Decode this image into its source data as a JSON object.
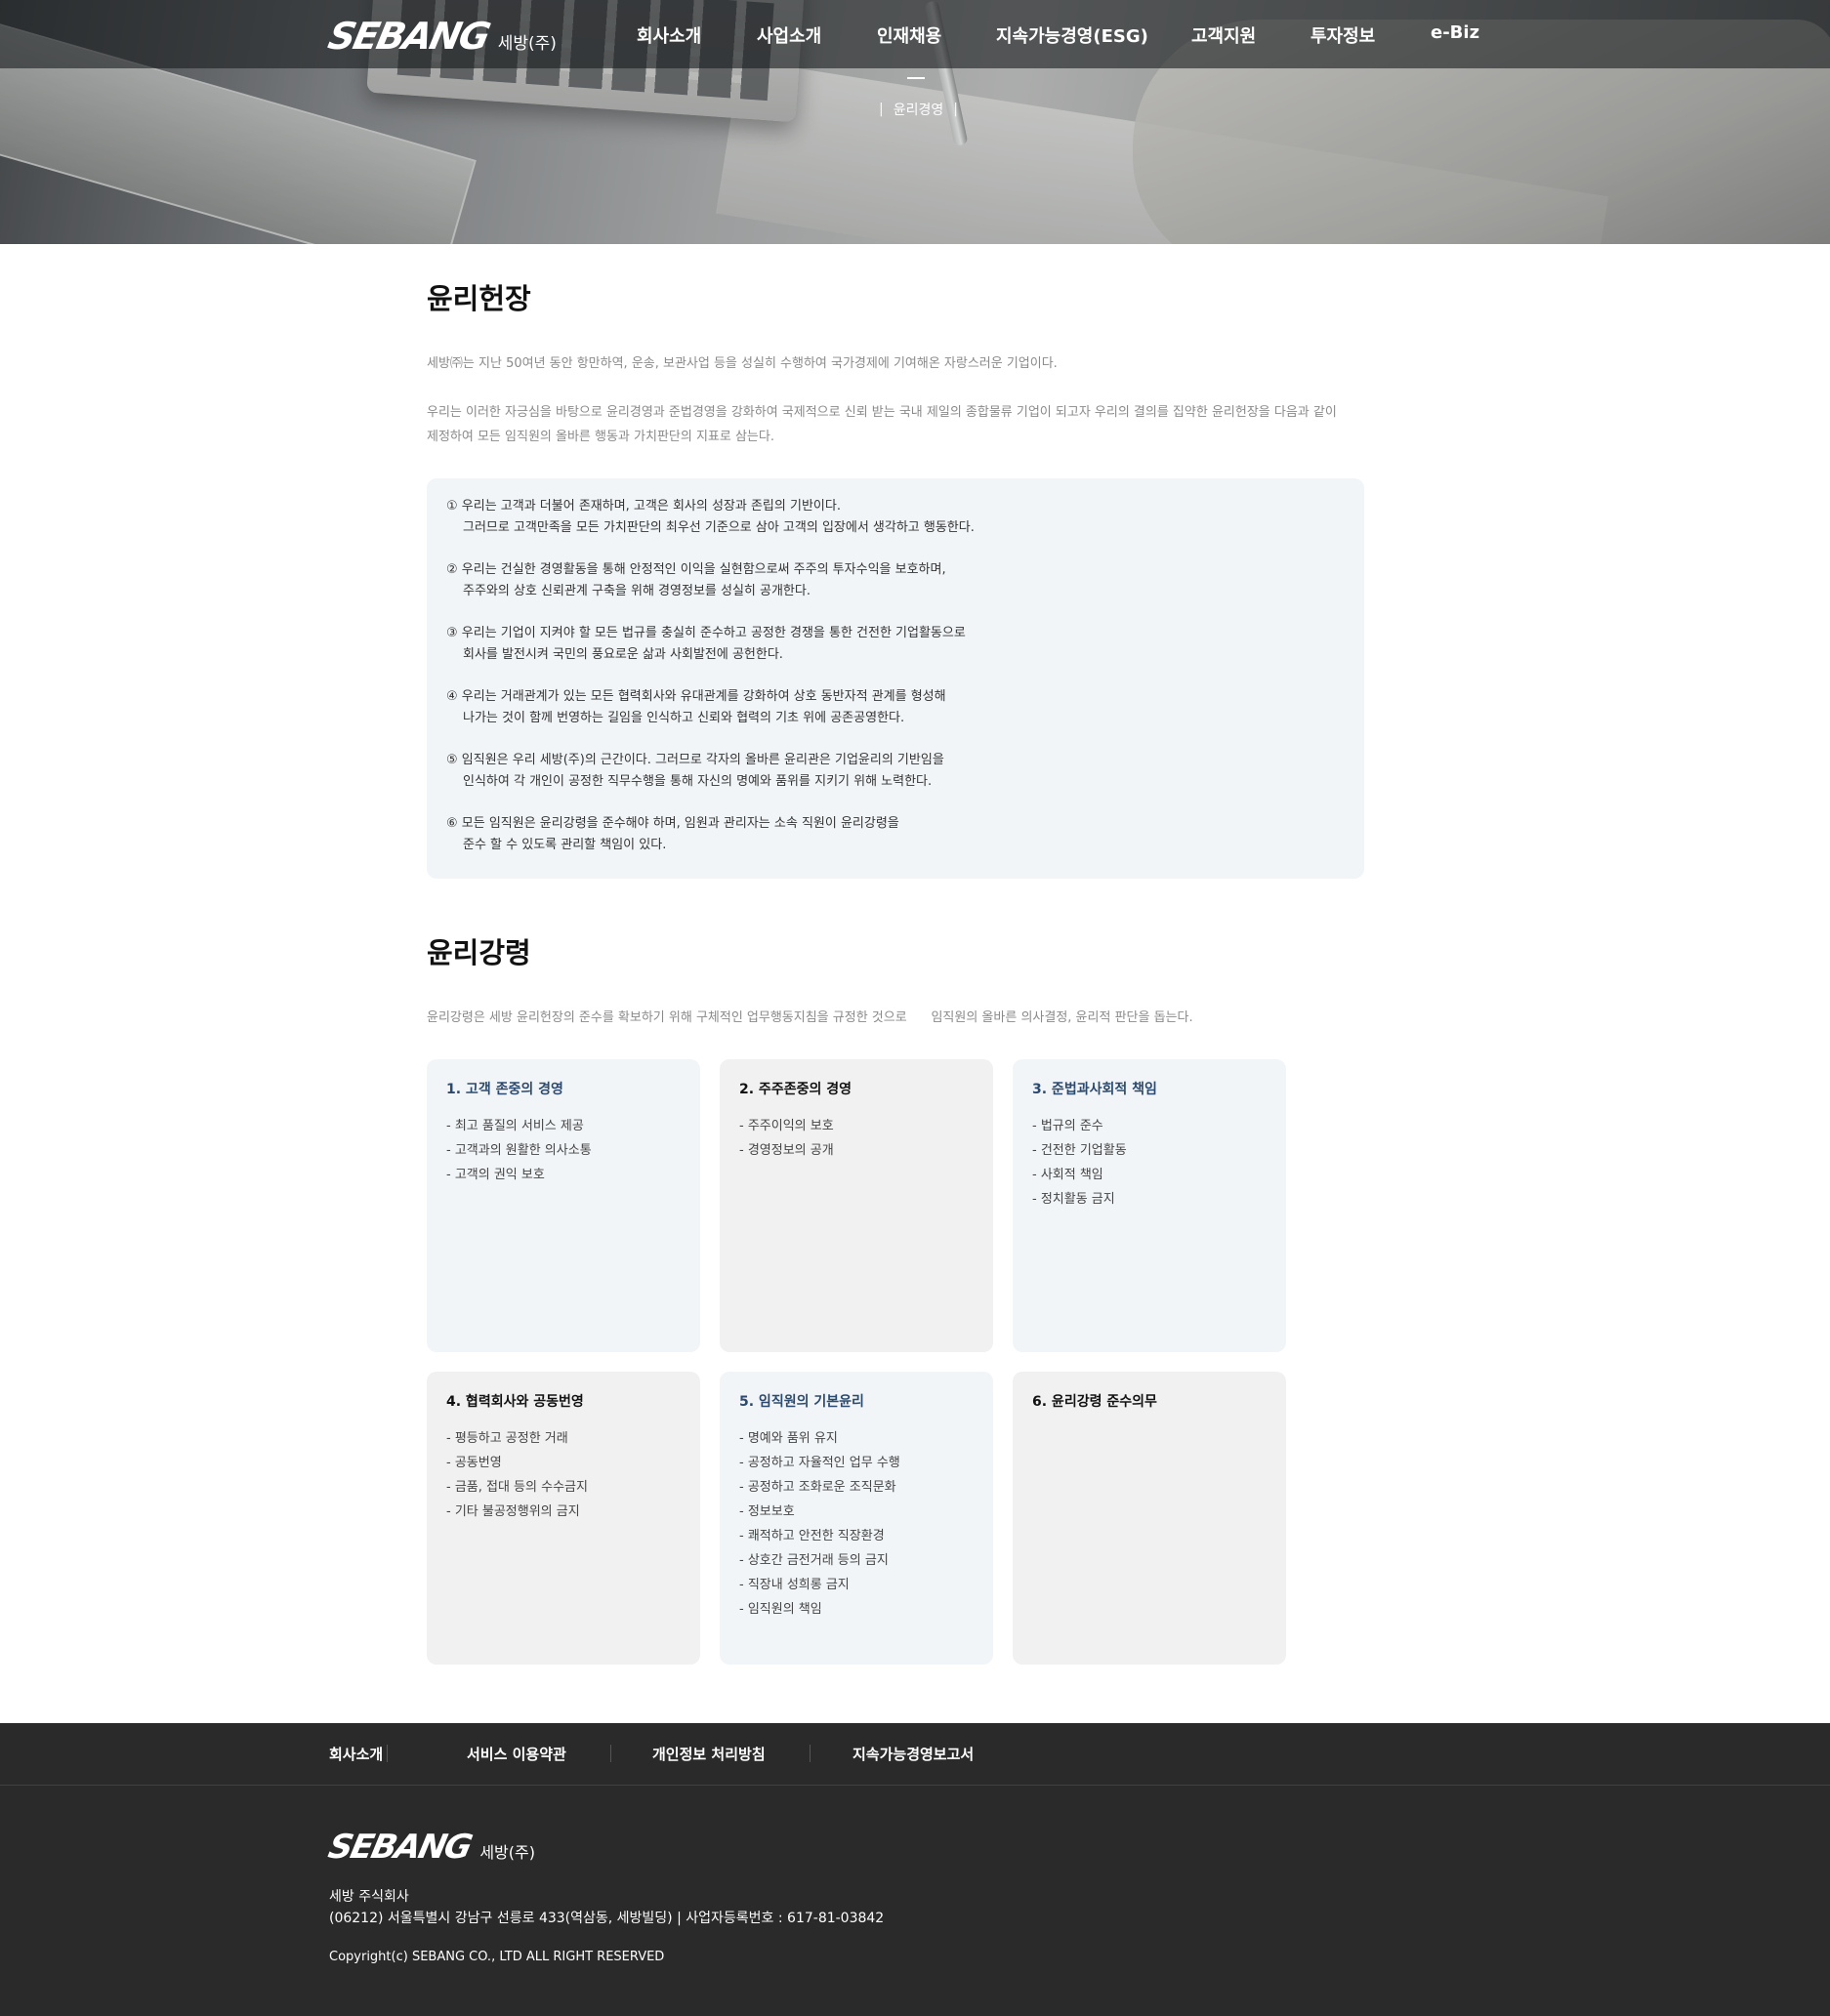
{
  "brand": {
    "logo_text": "SEBANG",
    "logo_sub": "세방(주)"
  },
  "nav": {
    "items": [
      "회사소개",
      "사업소개",
      "인재채용",
      "지속가능경영(ESG)",
      "고객지원",
      "투자정보",
      "e-Biz"
    ],
    "sub_active": "윤리경영"
  },
  "charter": {
    "title": "윤리헌장",
    "intro1": "세방㈜는 지난 50여년 동안 항만하역, 운송, 보관사업 등을 성실히 수행하여 국가경제에 기여해온 자랑스러운 기업이다.",
    "intro2a": "우리는 이러한 자긍심을 바탕으로 윤리경영과 준법경영을 강화하여 국제적으로 신뢰 받는 국내 제일의 종합물류 기업이 되고자 우리의 결의를 집약한 윤리헌장을 다음과 같이",
    "intro2b": "제정하여 모든 임직원의 올바른 행동과 가치판단의 지표로 삼는다.",
    "items": [
      {
        "l1": "① 우리는 고객과 더불어 존재하며, 고객은 회사의 성장과 존립의 기반이다.",
        "l2": "그러므로 고객만족을 모든 가치판단의 최우선 기준으로 삼아 고객의 입장에서 생각하고 행동한다."
      },
      {
        "l1": "② 우리는 건실한 경영활동을 통해 안정적인 이익을 실현함으로써 주주의 투자수익을 보호하며,",
        "l2": "주주와의 상호 신뢰관계 구축을 위해 경영정보를 성실히 공개한다."
      },
      {
        "l1": "③ 우리는 기업이 지켜야 할 모든 법규를 충실히 준수하고 공정한 경쟁을 통한 건전한 기업활동으로",
        "l2": "회사를 발전시켜 국민의 풍요로운 삶과 사회발전에 공헌한다."
      },
      {
        "l1": "④ 우리는 거래관계가 있는 모든 협력회사와 유대관계를 강화하여 상호 동반자적 관계를 형성해",
        "l2": "나가는 것이 함께 번영하는 길임을 인식하고 신뢰와 협력의 기초 위에 공존공영한다."
      },
      {
        "l1": "⑤ 임직원은 우리 세방(주)의 근간이다. 그러므로 각자의 올바른 윤리관은 기업윤리의 기반임을",
        "l2": "인식하여 각 개인이 공정한 직무수행을 통해 자신의 명예와 품위를 지키기 위해 노력한다."
      },
      {
        "l1": "⑥ 모든 임직원은 윤리강령을 준수해야 하며, 임원과 관리자는 소속 직원이 윤리강령을",
        "l2": "준수 할 수 있도록 관리할 책임이 있다."
      }
    ]
  },
  "code": {
    "title": "윤리강령",
    "intro": "윤리강령은 세방 윤리헌장의 준수를 확보하기 위해 구체적인 업무행동지침을 규정한 것으로      임직원의 올바른 의사결정, 윤리적 판단을 돕는다.",
    "cards": [
      {
        "title": "1. 고객 존중의 경영",
        "items": [
          "- 최고 품질의 서비스 제공",
          "- 고객과의 원활한 의사소통",
          "- 고객의 권익 보호"
        ]
      },
      {
        "title": "2. 주주존중의 경영",
        "items": [
          "- 주주이익의 보호",
          "- 경영정보의 공개"
        ]
      },
      {
        "title": "3. 준법과사회적 책임",
        "items": [
          "- 법규의 준수",
          "- 건전한 기업활동",
          "- 사회적 책임",
          "- 정치활동 금지"
        ]
      },
      {
        "title": "4. 협력회사와 공동번영",
        "items": [
          "- 평등하고 공정한 거래",
          "- 공동번영",
          "- 금품, 접대 등의 수수금지",
          "- 기타 불공정행위의 금지"
        ]
      },
      {
        "title": "5. 임직원의 기본윤리",
        "items": [
          "- 명예와 품위 유지",
          "- 공정하고 자율적인 업무 수행",
          "- 공정하고 조화로운 조직문화",
          "- 정보보호",
          "- 쾌적하고 안전한 직장환경",
          "- 상호간 금전거래 등의 금지",
          "- 직장내 성희롱 금지",
          "- 임직원의 책임"
        ]
      },
      {
        "title": "6. 윤리강령 준수의무",
        "items": []
      }
    ]
  },
  "footer": {
    "links": [
      "회사소개",
      "서비스 이용약관",
      "개인정보 처리방침",
      "지속가능경영보고서"
    ],
    "company": "세방 주식회사",
    "address": "(06212) 서울특별시 강남구 선릉로 433(역삼동, 세방빌딩) | 사업자등록번호 : 617-81-03842",
    "copyright": "Copyright(c) SEBANG CO., LTD ALL RIGHT RESERVED"
  },
  "colors": {
    "footer_bg": "#2a2a2a",
    "card_blue": "#f2f5f8",
    "card_gray": "#f1f1f1",
    "accent_title": "#2c4a6e"
  }
}
